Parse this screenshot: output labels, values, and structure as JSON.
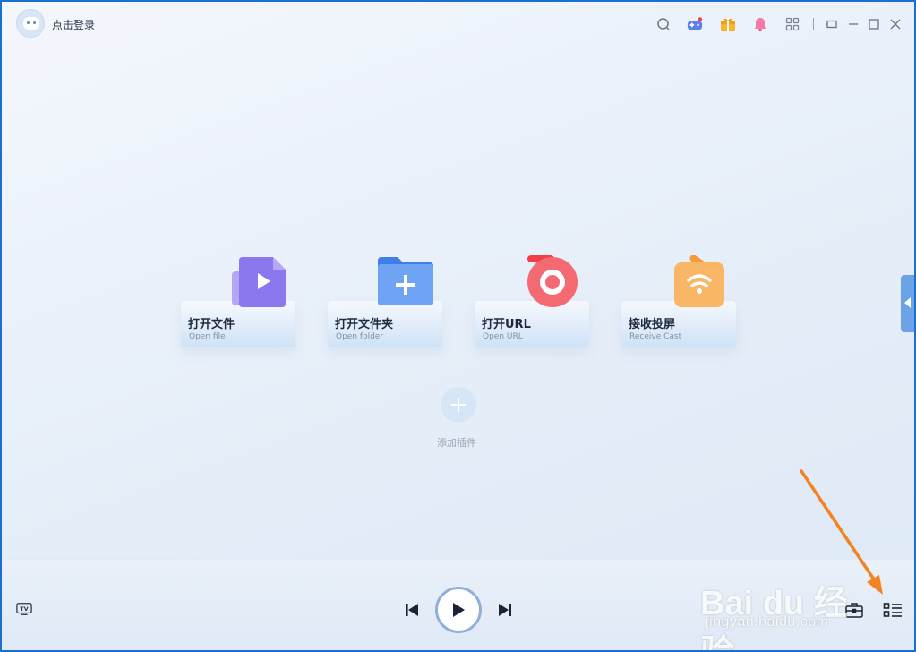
{
  "header": {
    "login_label": "点击登录"
  },
  "title_icons": [
    "search-icon",
    "game-icon",
    "gift-icon",
    "bell-icon",
    "apps-grid-icon",
    "mini-mode-icon",
    "minimize-icon",
    "maximize-icon",
    "close-icon"
  ],
  "notification_dot_color": "#f04646",
  "cards": [
    {
      "id": "open-file",
      "title": "打开文件",
      "subtitle": "Open file",
      "icon": "video-file-icon",
      "accent": "#8b78ef"
    },
    {
      "id": "open-folder",
      "title": "打开文件夹",
      "subtitle": "Open folder",
      "icon": "folder-add-icon",
      "accent": "#5d95f0"
    },
    {
      "id": "open-url",
      "title": "打开URL",
      "subtitle": "Open URL",
      "icon": "url-ring-icon",
      "accent": "#f0575f"
    },
    {
      "id": "receive-cast",
      "title": "接收投屏",
      "subtitle": "Receive Cast",
      "icon": "cast-wifi-icon",
      "accent": "#f7a04a"
    }
  ],
  "plugin": {
    "label": "添加插件"
  },
  "player": {
    "controls": [
      "tv-icon",
      "previous-icon",
      "play-icon",
      "next-icon",
      "toolbox-icon",
      "playlist-icon"
    ]
  },
  "watermark": {
    "brand": "Bai du 经验",
    "url": "jingyan.baidu.com"
  },
  "annotation_color": "#f58220"
}
